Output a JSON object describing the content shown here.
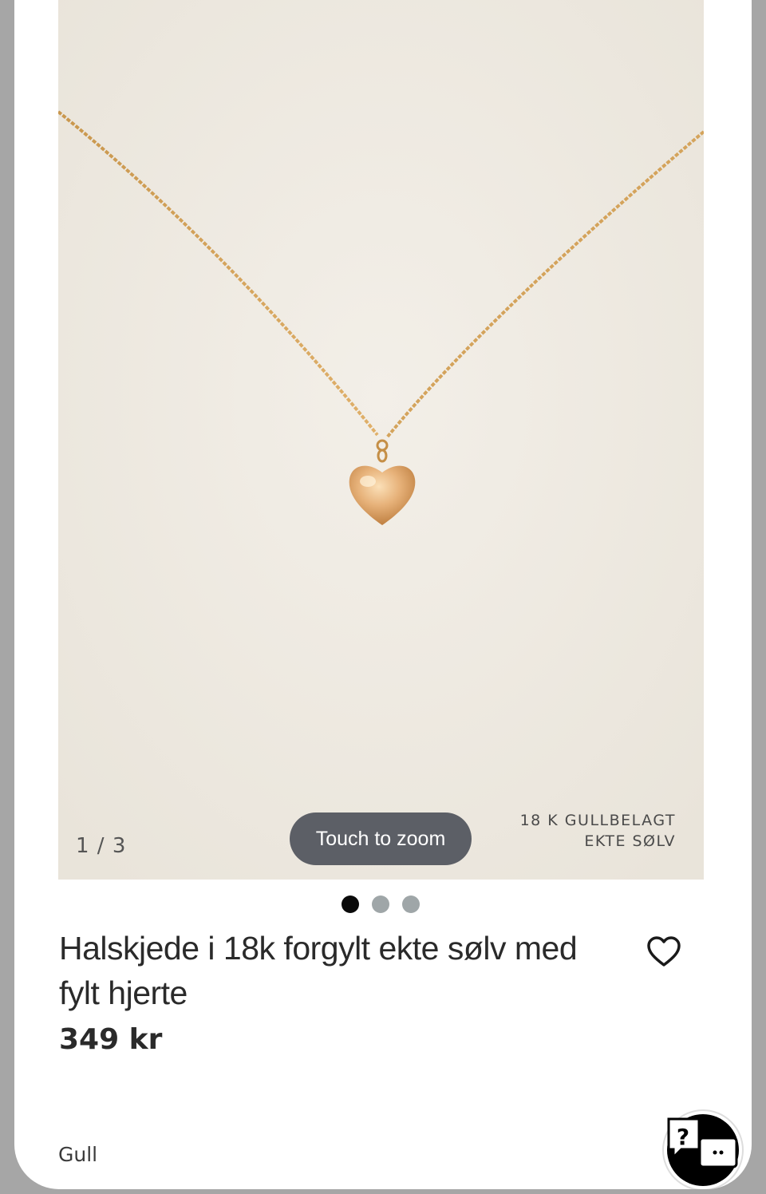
{
  "gallery": {
    "counter": "1 / 3",
    "zoom_hint": "Touch to zoom",
    "badge_line1": "18 K GULLBELAGT",
    "badge_line2": "EKTE SØLV",
    "dots_total": 3,
    "dots_active": 1
  },
  "product": {
    "title": "Halskjede i 18k forgylt ekte sølv med fylt hjerte",
    "price": "349 kr",
    "color": "Gull"
  },
  "icons": {
    "favorite": "heart-outline-icon",
    "help": "chat-question-icon"
  },
  "colors": {
    "photo_background": "#efebe3",
    "gold": "#d9a45a",
    "pill": "#5c5f66",
    "dot_active": "#0a0a0a",
    "dot_inactive": "#9fa6a8"
  }
}
